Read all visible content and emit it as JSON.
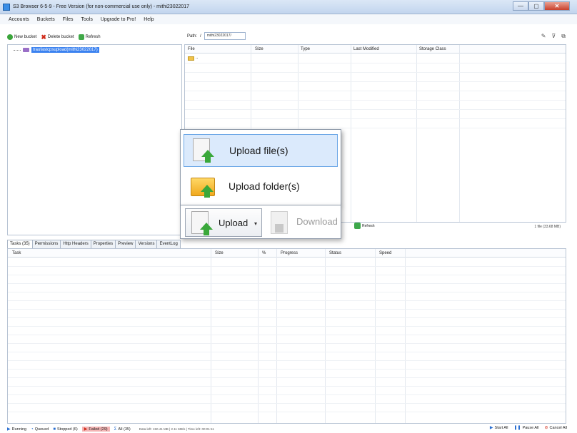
{
  "window": {
    "title": "S3 Browser 6-5-9 - Free Version (for non-commercial use only) - mithi23022017",
    "minimize": "—",
    "maximize": "▢",
    "close": "✕"
  },
  "menu": [
    "Accounts",
    "Buckets",
    "Files",
    "Tools",
    "Upgrade to Pro!",
    "Help"
  ],
  "toolbar": {
    "new_bucket": "New bucket",
    "delete_bucket": "Delete bucket",
    "refresh": "Refresh"
  },
  "path": {
    "label": "Path:",
    "separator": "/",
    "value": "mithi23022017/"
  },
  "tree": {
    "selected_bucket": "traufastcpsupload(mithi23022017)"
  },
  "file_columns": [
    "File",
    "Size",
    "Type",
    "Last Modified",
    "Storage Class"
  ],
  "file_rows": [
    ".."
  ],
  "popup": {
    "upload_files": "Upload file(s)",
    "upload_folder": "Upload folder(s)"
  },
  "actions": {
    "upload": "Upload",
    "download": "Download",
    "refresh": "Refresh",
    "file_count": "1 file (33.68 MB)"
  },
  "tabs": [
    "Tasks (35)",
    "Permissions",
    "Http Headers",
    "Properties",
    "Preview",
    "Versions",
    "EventLog"
  ],
  "task_columns": [
    "Task",
    "Size",
    "%",
    "Progress",
    "Status",
    "Speed"
  ],
  "statusbar": {
    "running": "Running",
    "queued": "Queued",
    "stopped": "Stopped (6)",
    "failed": "Failed (29)",
    "all": "All (35)",
    "info": "Data left: 150.41 MB | 2.11 MB/s | Time left: 00:01:11",
    "start_all": "Start All",
    "pause_all": "Pause All",
    "cancel_all": "Cancel All"
  }
}
